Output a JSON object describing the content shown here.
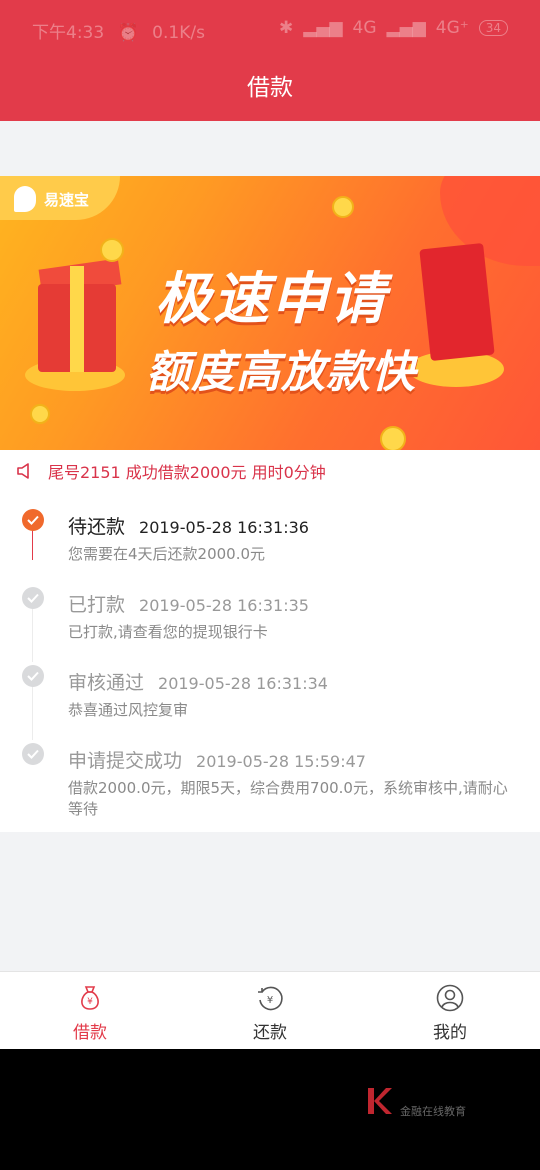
{
  "status_bar": {
    "time": "下午4:33",
    "speed": "0.1K/s",
    "network1": "4G",
    "network2": "4G⁺",
    "battery": "34"
  },
  "header": {
    "title": "借款"
  },
  "banner": {
    "logo_text": "易速宝",
    "headline": "极速申请",
    "subline": "额度高放款快"
  },
  "notice": {
    "text": "尾号2151 成功借款2000元 用时0分钟"
  },
  "timeline": [
    {
      "status": "待还款",
      "time": "2019-05-28 16:31:36",
      "detail": "您需要在4天后还款2000.0元",
      "active": true
    },
    {
      "status": "已打款",
      "time": "2019-05-28 16:31:35",
      "detail": "已打款,请查看您的提现银行卡",
      "active": false
    },
    {
      "status": "审核通过",
      "time": "2019-05-28 16:31:34",
      "detail": "恭喜通过风控复审",
      "active": false
    },
    {
      "status": "申请提交成功",
      "time": "2019-05-28 15:59:47",
      "detail": "借款2000.0元，期限5天，综合费用700.0元，系统审核中,请耐心等待",
      "active": false
    }
  ],
  "tabs": [
    {
      "label": "借款",
      "icon": "money-bag-icon",
      "active": true
    },
    {
      "label": "还款",
      "icon": "repay-icon",
      "active": false
    },
    {
      "label": "我的",
      "icon": "user-icon",
      "active": false
    }
  ],
  "watermark": {
    "text": "金融在线教育"
  },
  "colors": {
    "primary": "#e23b4a",
    "active_step": "#f0692c",
    "inactive_step": "#d9dadc"
  }
}
